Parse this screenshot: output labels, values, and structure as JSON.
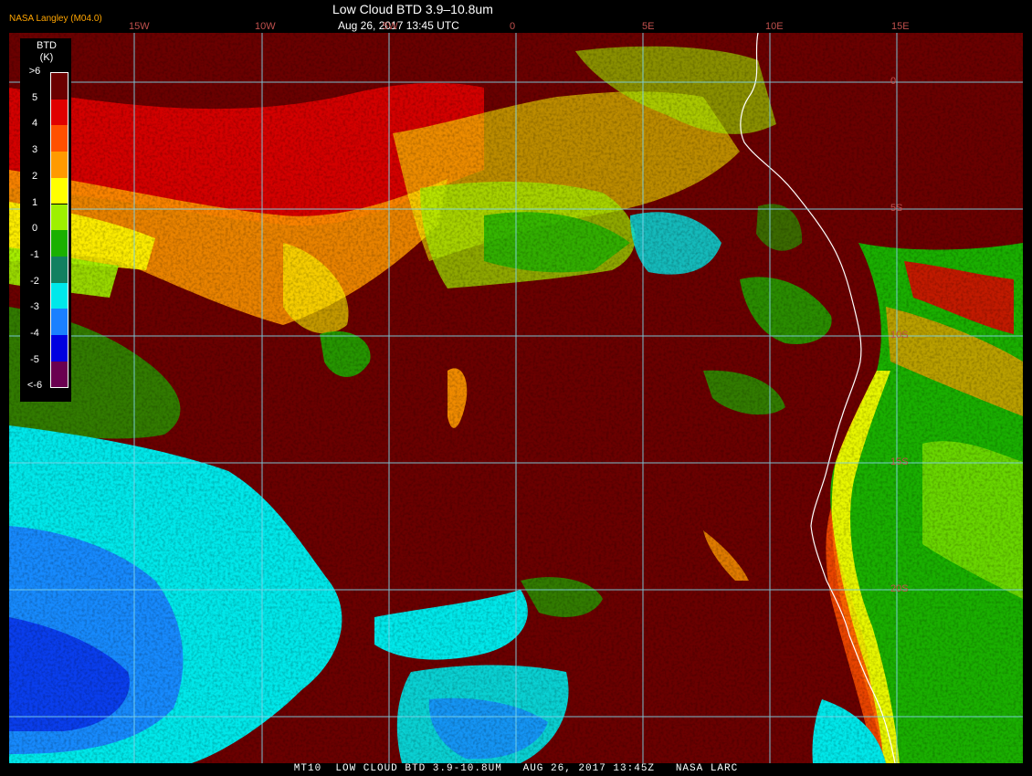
{
  "header": {
    "credit": "NASA Langley (M04.0)",
    "title": "Low Cloud BTD 3.9–10.8um",
    "datetime": "Aug 26, 2017 13:45 UTC"
  },
  "longitude_labels": [
    "15W",
    "10W",
    "5W",
    "0",
    "5E",
    "10E",
    "15E"
  ],
  "latitude_labels": [
    "0",
    "5S",
    "10S",
    "15S",
    "20S"
  ],
  "legend": {
    "title": "BTD",
    "unit": "(K)",
    "entries": [
      {
        "label": ">6",
        "color": "#6b0000"
      },
      {
        "label": "5",
        "color": "#e00000"
      },
      {
        "label": "4",
        "color": "#ff5000"
      },
      {
        "label": "3",
        "color": "#ff9a00"
      },
      {
        "label": "2",
        "color": "#ffff00"
      },
      {
        "label": "1",
        "color": "#9ef000"
      },
      {
        "label": "0",
        "color": "#1ab000"
      },
      {
        "label": "-1",
        "color": "#128060"
      },
      {
        "label": "-2",
        "color": "#00e8ea"
      },
      {
        "label": "-3",
        "color": "#1a80ff"
      },
      {
        "label": "-4",
        "color": "#0000e0"
      },
      {
        "label": "-5",
        "color": "#6a0050"
      },
      {
        "label": "<-6",
        "color": "#6a0050"
      }
    ]
  },
  "colors": {
    "ocean_background": "#6b0000",
    "gridline": "#7fd4e8",
    "coastline": "#ffffff",
    "label_orange": "#ffa500",
    "lat_lon_label": "#c0504d"
  },
  "footer": {
    "text": "MT10  LOW CLOUD BTD 3.9-10.8UM   AUG 26, 2017 13:45Z   NASA LARC"
  }
}
